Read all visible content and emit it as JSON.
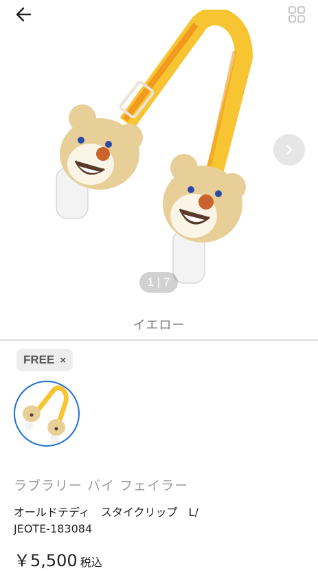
{
  "gallery": {
    "counter": "1 | 7",
    "variant_label": "イエロー"
  },
  "size_chip": {
    "label": "FREE",
    "remove_symbol": "×"
  },
  "product": {
    "brand": "ラブラリー バイ フェイラー",
    "title_line1": "オールドテディ　スタイクリップ　L/",
    "title_line2": "JEOTE-183084",
    "price": "￥5,500",
    "tax_label": "税込"
  },
  "icons": {
    "back": "arrow-left-icon",
    "grid": "grid-icon",
    "next": "chevron-right-icon"
  },
  "colors": {
    "strap_yellow": "#f7c531",
    "strap_orange": "#f29a1e",
    "bear_tan": "#e8cf98",
    "selected_border": "#1f6fd6"
  }
}
